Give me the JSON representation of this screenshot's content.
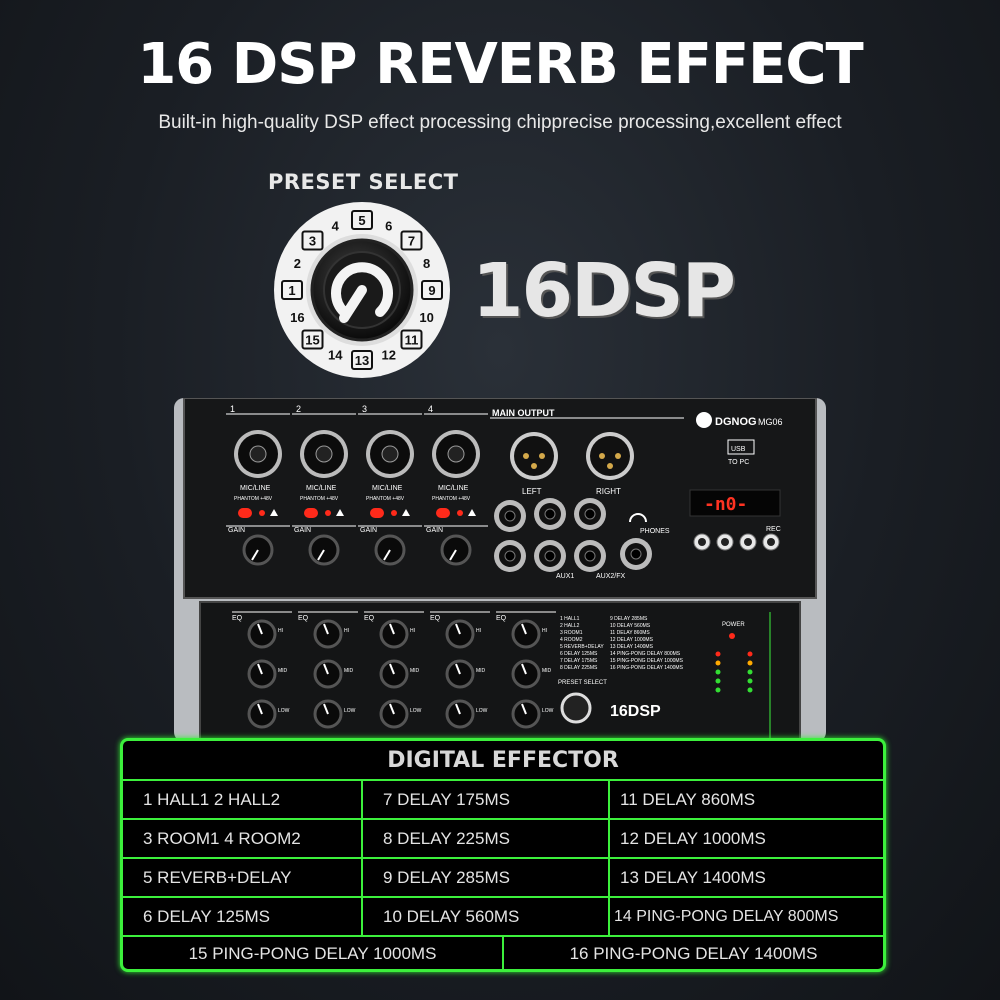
{
  "headline": "16 DSP REVERB EFFECT",
  "subline": "Built-in high-quality DSP effect processing chipprecise processing,excellent effect",
  "dial": {
    "label": "PRESET SELECT",
    "numbers": [
      "1",
      "2",
      "3",
      "4",
      "5",
      "6",
      "7",
      "8",
      "9",
      "10",
      "11",
      "12",
      "13",
      "14",
      "15",
      "16"
    ],
    "dsp_text": "16DSP"
  },
  "mixer": {
    "brand": "DGNOG",
    "model": "MG06",
    "display": "-n0-",
    "channels": [
      "1",
      "2",
      "3",
      "4"
    ],
    "main_output": "MAIN OUTPUT",
    "mic_line": "MIC/LINE",
    "phantom": "PHANTOM +48V",
    "gain": "GAIN",
    "left": "LEFT",
    "right": "RIGHT",
    "phones": "PHONES",
    "usb": "USB",
    "to_pc": "TO PC",
    "rec": "REC",
    "aux1": "AUX1",
    "aux2fx": "AUX2/FX",
    "eq": "EQ",
    "hi": "HI",
    "mid": "MID",
    "low": "LOW",
    "power": "POWER",
    "preset_small": "PRESET SELECT",
    "dsp_small": "16DSP",
    "effect_list_left": [
      "1 HALL1",
      "2 HALL2",
      "3 ROOM1",
      "4 ROOM2",
      "5 REVERB+DELAY",
      "6 DELAY 125MS",
      "7 DELAY 175MS",
      "8 DELAY 225MS"
    ],
    "effect_list_right": [
      "9 DELAY 285MS",
      "10 DELAY 560MS",
      "11 DELAY 860MS",
      "12 DELAY 1000MS",
      "13 DELAY 1400MS",
      "14 PING-PONG DELAY 800MS",
      "15 PING-PONG DELAY 1000MS",
      "16 PING-PONG DELAY 1400MS"
    ]
  },
  "effector": {
    "title": "DIGITAL EFFECTOR",
    "rows": [
      [
        "1 HALL1 2 HALL2",
        "7 DELAY 175MS",
        "11 DELAY 860MS"
      ],
      [
        "3 ROOM1 4 ROOM2",
        "8 DELAY 225MS",
        "12 DELAY 1000MS"
      ],
      [
        "5 REVERB+DELAY",
        "9 DELAY 285MS",
        "13 DELAY 1400MS"
      ],
      [
        "6 DELAY 125MS",
        "10 DELAY 560MS",
        "14 PING-PONG DELAY 800MS"
      ]
    ],
    "last_row": [
      "15 PING-PONG DELAY 1000MS",
      "16 PING-PONG DELAY 1400MS"
    ]
  },
  "colors": {
    "accent_green": "#3cf03c",
    "led_red": "#ff2a1a",
    "display_red": "#ff3322"
  }
}
